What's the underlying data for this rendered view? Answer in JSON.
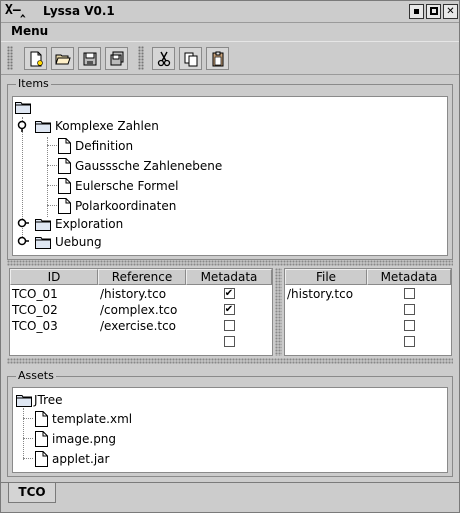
{
  "window": {
    "logo": "X—‸",
    "title": "Lyssa V0.1"
  },
  "menu": {
    "label": "Menu"
  },
  "toolbar": {
    "buttons": [
      {
        "icon": "new-document-icon"
      },
      {
        "icon": "open-folder-icon"
      },
      {
        "icon": "save-icon"
      },
      {
        "icon": "save-all-icon"
      },
      {
        "icon": "cut-icon"
      },
      {
        "icon": "copy-icon"
      },
      {
        "icon": "paste-icon"
      }
    ]
  },
  "items": {
    "label": "Items",
    "nodes": [
      {
        "label": "Komplexe Zahlen",
        "children": [
          "Definition",
          "Gausssche Zahlenebene",
          "Eulersche Formel",
          "Polarkoordinaten"
        ]
      },
      {
        "label": "Exploration"
      },
      {
        "label": "Uebung"
      }
    ]
  },
  "tco_table": {
    "headers": [
      "ID",
      "Reference",
      "Metadata"
    ],
    "rows": [
      {
        "id": "TCO_01",
        "reference": "/history.tco",
        "metadata": true
      },
      {
        "id": "TCO_02",
        "reference": "/complex.tco",
        "metadata": true
      },
      {
        "id": "TCO_03",
        "reference": "/exercise.tco",
        "metadata": false
      },
      {
        "id": "",
        "reference": "",
        "metadata": false
      }
    ]
  },
  "file_table": {
    "headers": [
      "File",
      "Metadata"
    ],
    "rows": [
      {
        "file": "/history.tco",
        "metadata": false
      },
      {
        "file": "",
        "metadata": false
      },
      {
        "file": "",
        "metadata": false
      },
      {
        "file": "",
        "metadata": false
      }
    ]
  },
  "assets": {
    "label": "Assets",
    "root": "JTree",
    "files": [
      "template.xml",
      "image.png",
      "applet.jar"
    ]
  },
  "tabs": [
    {
      "label": "TCO",
      "active": true
    }
  ],
  "check_mark": "✔"
}
